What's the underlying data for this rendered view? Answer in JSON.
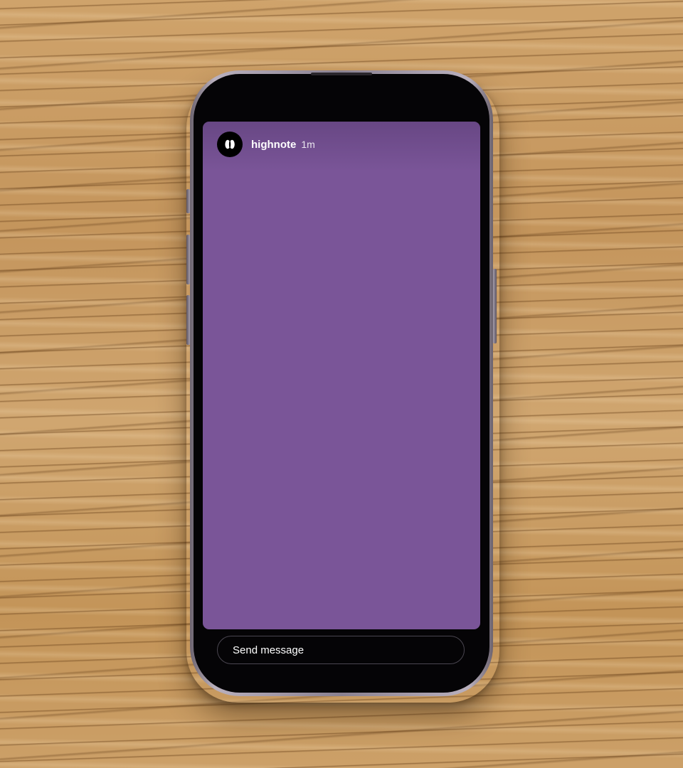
{
  "story": {
    "username": "highnote",
    "timestamp": "1m",
    "background_color": "#7a5598",
    "avatar_icon": "highnote-logo-icon"
  },
  "composer": {
    "placeholder": "Send message"
  }
}
